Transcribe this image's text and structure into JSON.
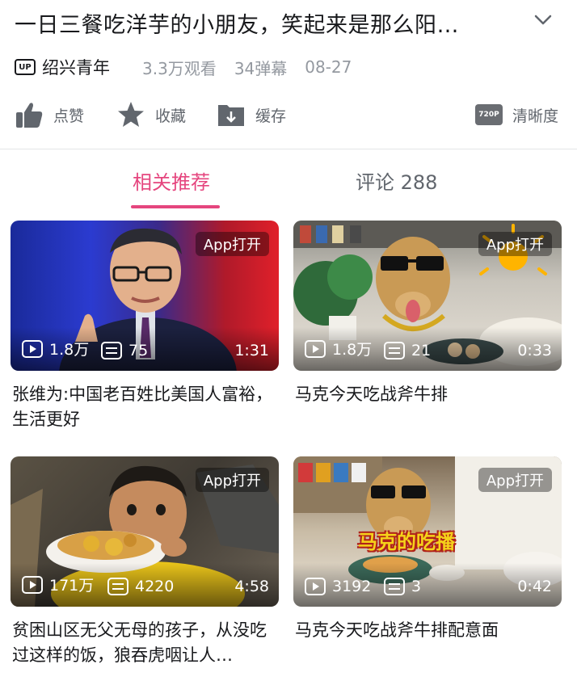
{
  "video": {
    "title": "一日三餐吃洋芋的小朋友，笑起来是那么阳…",
    "up_badge": "UP",
    "author": "绍兴青年",
    "views": "3.3万观看",
    "danmaku": "34弹幕",
    "date": "08-27"
  },
  "actions": {
    "like": "点赞",
    "favorite": "收藏",
    "cache": "缓存",
    "quality_badge": "720P",
    "quality": "清晰度"
  },
  "tabs": {
    "related": "相关推荐",
    "comments": "评论 288"
  },
  "colors": {
    "accent": "#e5457e",
    "text_secondary": "#9499a0"
  },
  "cards": [
    {
      "open_label": "App打开",
      "plays": "1.8万",
      "danmaku": "75",
      "duration": "1:31",
      "title": "张维为:中国老百姓比美国人富裕，生活更好"
    },
    {
      "open_label": "App打开",
      "plays": "1.8万",
      "danmaku": "21",
      "duration": "0:33",
      "title": "马克今天吃战斧牛排"
    },
    {
      "open_label": "App打开",
      "plays": "171万",
      "danmaku": "4220",
      "duration": "4:58",
      "title": "贫困山区无父无母的孩子，从没吃过这样的饭，狼吞虎咽让人…"
    },
    {
      "open_label": "App打开",
      "plays": "3192",
      "danmaku": "3",
      "duration": "0:42",
      "title": "马克今天吃战斧牛排配意面",
      "overlay_text": "马克的吃播"
    }
  ]
}
